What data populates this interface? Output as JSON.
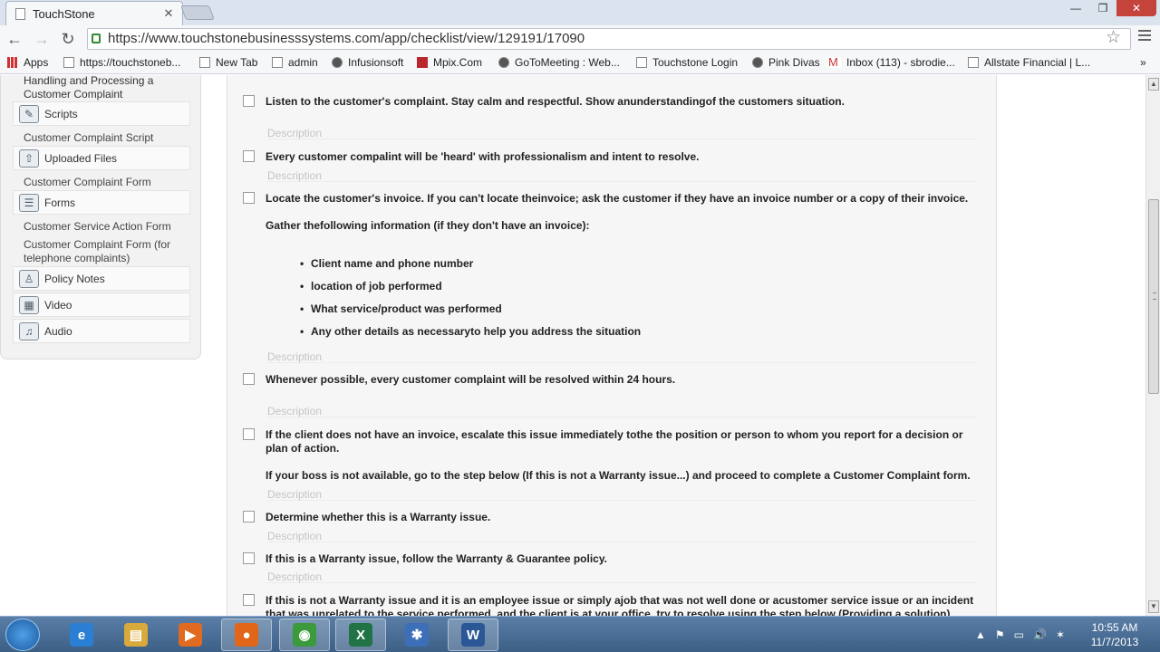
{
  "browser": {
    "tab_title": "TouchStone",
    "tab_close": "✕",
    "url": "https://www.touchstonebusinesssystems.com/app/checklist/view/129191/17090",
    "bookmarks": [
      {
        "label": "Apps",
        "icon": "apps-grid-icon"
      },
      {
        "label": "https://touchstoneb...",
        "icon": "page-icon"
      },
      {
        "label": "New Tab",
        "icon": "page-icon"
      },
      {
        "label": "admin",
        "icon": "page-icon"
      },
      {
        "label": "Infusionsoft",
        "icon": "infusionsoft-icon"
      },
      {
        "label": "Mpix.Com",
        "icon": "mpix-icon"
      },
      {
        "label": "GoToMeeting : Web...",
        "icon": "gotomeeting-icon"
      },
      {
        "label": "Touchstone Login",
        "icon": "page-icon"
      },
      {
        "label": "Pink Divas",
        "icon": "pink-divas-icon"
      },
      {
        "label": "Inbox (113) - sbrodie...",
        "icon": "gmail-icon"
      },
      {
        "label": "Allstate Financial | L...",
        "icon": "page-icon"
      }
    ],
    "more_bookmarks": "»"
  },
  "sidebar": {
    "partial_item": "Handling and Processing a Customer Complaint",
    "sections": [
      {
        "label": "Scripts",
        "icon": "scripts-icon",
        "items": [
          "Customer Complaint Script"
        ]
      },
      {
        "label": "Uploaded Files",
        "icon": "upload-icon",
        "items": [
          "Customer Complaint Form"
        ]
      },
      {
        "label": "Forms",
        "icon": "forms-icon",
        "items": [
          "Customer Service Action Form",
          "Customer Complaint Form (for telephone complaints)"
        ]
      },
      {
        "label": "Policy Notes",
        "icon": "policy-notes-icon",
        "items": []
      },
      {
        "label": "Video",
        "icon": "video-icon",
        "items": []
      },
      {
        "label": "Audio",
        "icon": "audio-icon",
        "items": []
      }
    ]
  },
  "checklist": {
    "description_placeholder": "Description",
    "items": [
      {
        "text": "Listen to the customer's complaint. Stay calm and respectful. Show anunderstandingof the customers situation."
      },
      {
        "text": "Every customer compalint will be 'heard' with professionalism and intent to resolve."
      },
      {
        "text": "Locate the customer's invoice. If you can't locate theinvoice; ask the customer if they have an invoice number or a copy of their invoice.",
        "extra": "Gather thefollowing information (if they don't have an invoice):",
        "bullets": [
          "Client name and phone number",
          "location of job performed",
          "What service/product was performed",
          "Any other details as necessaryto help you address the situation"
        ]
      },
      {
        "text": "Whenever possible, every customer complaint will be resolved within 24 hours."
      },
      {
        "text": "If the client does not have an invoice, escalate this issue immediately tothe the position or person to whom you report for a decision or plan of action.",
        "extra": "If your boss is not available, go to the step below (If this is not a Warranty issue...) and proceed to complete a Customer Complaint form."
      },
      {
        "text": "Determine whether this is a Warranty issue."
      },
      {
        "text": "If this is a Warranty issue, follow the Warranty & Guarantee policy."
      },
      {
        "text": "If this is not a Warranty issue and it is an employee issue or simply ajob that was not well done or acustomer service issue or an incident that was unrelated to the service performed, and the client is at your office, try to resolve using the step below (Providing a solution)."
      }
    ]
  },
  "taskbar": {
    "apps": [
      {
        "name": "internet-explorer",
        "glyph": "e",
        "color": "#2a7fd4"
      },
      {
        "name": "file-explorer",
        "glyph": "▤",
        "color": "#d9a93b"
      },
      {
        "name": "media-player",
        "glyph": "▶",
        "color": "#e06a1f"
      },
      {
        "name": "firefox",
        "glyph": "●",
        "color": "#e2661a"
      },
      {
        "name": "chrome",
        "glyph": "◉",
        "color": "#3b9a3b"
      },
      {
        "name": "excel",
        "glyph": "X",
        "color": "#217346"
      },
      {
        "name": "snipping-tool",
        "glyph": "✱",
        "color": "#3d6fb8"
      },
      {
        "name": "word",
        "glyph": "W",
        "color": "#2b5797"
      }
    ],
    "tray": [
      "▲",
      "⚑",
      "▭",
      "🔊",
      "✶"
    ],
    "time": "10:55 AM",
    "date": "11/7/2013"
  }
}
